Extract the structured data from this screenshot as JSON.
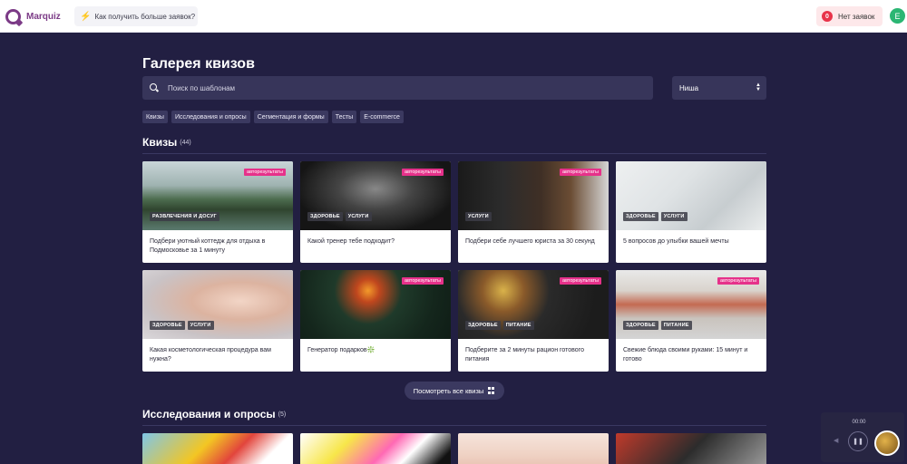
{
  "topbar": {
    "logo_text": "Marquiz",
    "tip_text": "Как получить больше заявок?",
    "leads_count": "0",
    "leads_text": "Нет заявок",
    "avatar_letter": "E"
  },
  "gallery": {
    "title": "Галерея квизов",
    "search_placeholder": "Поиск по шаблонам",
    "niche_label": "Ниша",
    "chips": [
      "Квизы",
      "Исследования и опросы",
      "Сегментация и формы",
      "Тесты",
      "E-commerce"
    ]
  },
  "quizzes": {
    "title": "Квизы",
    "count": "(44)",
    "cards": [
      {
        "title": "Подбери уютный коттедж для отдыха в Подмосковье за 1 минуту",
        "tags": [
          "РАЗВЛЕЧЕНИЯ И ДОСУГ"
        ],
        "badge": "авторезультаты"
      },
      {
        "title": "Какой тренер тебе подходит?",
        "tags": [
          "ЗДОРОВЬЕ",
          "УСЛУГИ"
        ],
        "badge": "авторезультаты"
      },
      {
        "title": "Подбери себе лучшего юриста за 30 секунд",
        "tags": [
          "УСЛУГИ"
        ],
        "badge": "авторезультаты"
      },
      {
        "title": "5 вопросов до улыбки вашей мечты",
        "tags": [
          "ЗДОРОВЬЕ",
          "УСЛУГИ"
        ],
        "badge": ""
      },
      {
        "title": "Какая косметологическая процедура вам нужна?",
        "tags": [
          "ЗДОРОВЬЕ",
          "УСЛУГИ"
        ],
        "badge": ""
      },
      {
        "title": "Генератор подарков❇️",
        "tags": [],
        "badge": "авторезультаты"
      },
      {
        "title": "Подберите за 2 минуты рацион готового питания",
        "tags": [
          "ЗДОРОВЬЕ",
          "ПИТАНИЕ"
        ],
        "badge": "авторезультаты"
      },
      {
        "title": "Свежие блюда своими руками: 15 минут и готово",
        "tags": [
          "ЗДОРОВЬЕ",
          "ПИТАНИЕ"
        ],
        "badge": "авторезультаты"
      }
    ],
    "more_button": "Посмотреть все квизы"
  },
  "surveys": {
    "title": "Исследования и опросы",
    "count": "(5)"
  },
  "player": {
    "time": "00:00"
  },
  "colors": {
    "background": "#221f42",
    "accent_pink": "#e6318a",
    "brand": "#7b3a86",
    "leads_red": "#e8334a",
    "avatar_green": "#2bb673"
  }
}
